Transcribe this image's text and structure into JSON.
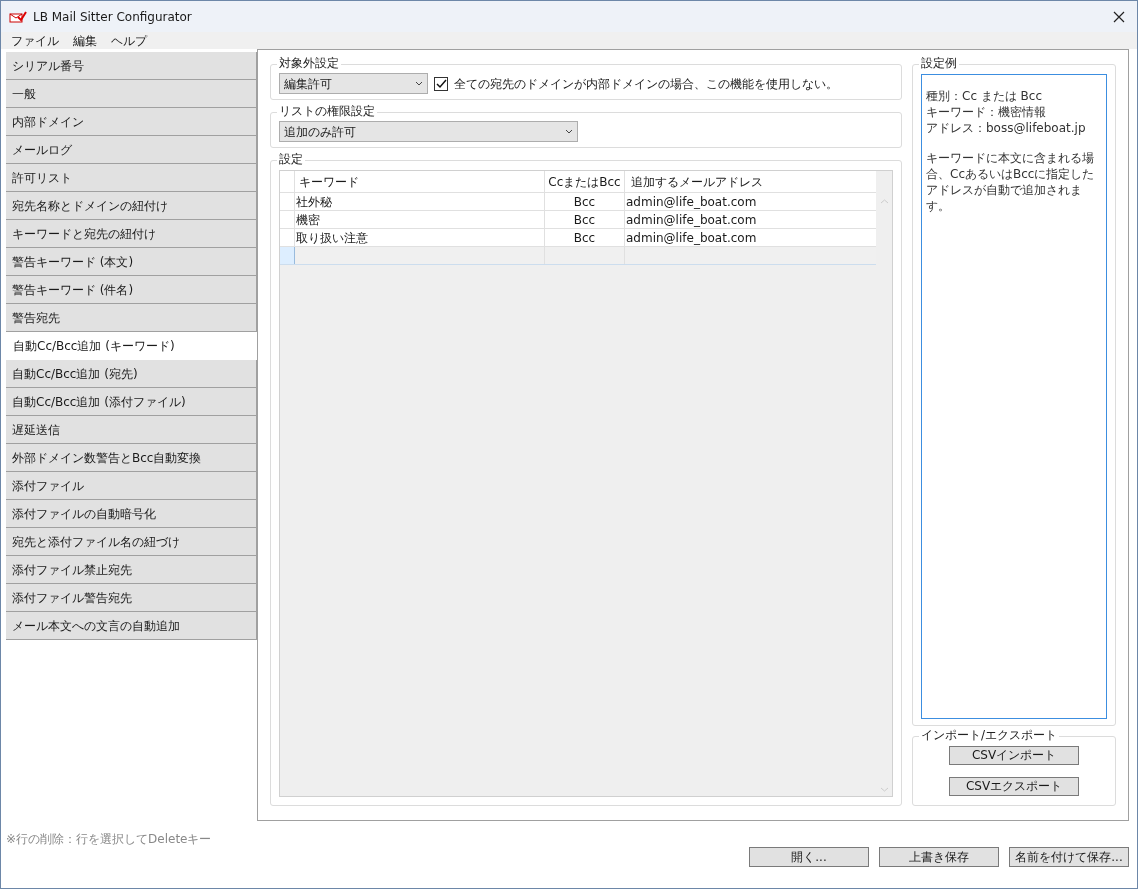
{
  "window": {
    "title": "LB Mail Sitter Configurator"
  },
  "menu": [
    "ファイル",
    "編集",
    "ヘルプ"
  ],
  "sidebar": {
    "items": [
      {
        "label": "シリアル番号",
        "selected": false
      },
      {
        "label": "一般",
        "selected": false
      },
      {
        "label": "内部ドメイン",
        "selected": false
      },
      {
        "label": "メールログ",
        "selected": false
      },
      {
        "label": "許可リスト",
        "selected": false
      },
      {
        "label": "宛先名称とドメインの紐付け",
        "selected": false
      },
      {
        "label": "キーワードと宛先の紐付け",
        "selected": false
      },
      {
        "label": "警告キーワード (本文)",
        "selected": false
      },
      {
        "label": "警告キーワード (件名)",
        "selected": false
      },
      {
        "label": "警告宛先",
        "selected": false
      },
      {
        "label": "自動Cc/Bcc追加 (キーワード)",
        "selected": true
      },
      {
        "label": "自動Cc/Bcc追加 (宛先)",
        "selected": false
      },
      {
        "label": "自動Cc/Bcc追加 (添付ファイル)",
        "selected": false
      },
      {
        "label": "遅延送信",
        "selected": false
      },
      {
        "label": "外部ドメイン数警告とBcc自動変換",
        "selected": false
      },
      {
        "label": "添付ファイル",
        "selected": false
      },
      {
        "label": "添付ファイルの自動暗号化",
        "selected": false
      },
      {
        "label": "宛先と添付ファイル名の紐づけ",
        "selected": false
      },
      {
        "label": "添付ファイル禁止宛先",
        "selected": false
      },
      {
        "label": "添付ファイル警告宛先",
        "selected": false
      },
      {
        "label": "メール本文への文言の自動追加",
        "selected": false
      }
    ]
  },
  "exclusion": {
    "title": "対象外設定",
    "dropdown": "編集許可",
    "checkbox": {
      "label": "全ての宛先のドメインが内部ドメインの場合、この機能を使用しない。",
      "checked": true
    }
  },
  "permission": {
    "title": "リストの権限設定",
    "dropdown": "追加のみ許可"
  },
  "settings": {
    "title": "設定",
    "table": {
      "columns": [
        "キーワード",
        "CcまたはBcc",
        "追加するメールアドレス"
      ],
      "rows": [
        [
          "社外秘",
          "Bcc",
          "admin@life_boat.com"
        ],
        [
          "機密",
          "Bcc",
          "admin@life_boat.com"
        ],
        [
          "取り扱い注意",
          "Bcc",
          "admin@life_boat.com"
        ]
      ]
    }
  },
  "example": {
    "title": "設定例",
    "lines": [
      "種別：Cc または Bcc",
      "キーワード：機密情報",
      "アドレス：boss@lifeboat.jp"
    ],
    "note": "キーワードに本文に含まれる場合、CcあるいはBccに指定したアドレスが自動で追加されます。"
  },
  "import_export": {
    "title": "インポート/エクスポート",
    "buttons": [
      "CSVインポート",
      "CSVエクスポート"
    ]
  },
  "hint": "※行の削除：行を選択してDeleteキー",
  "footer_buttons": [
    "開く...",
    "上書き保存",
    "名前を付けて保存..."
  ]
}
